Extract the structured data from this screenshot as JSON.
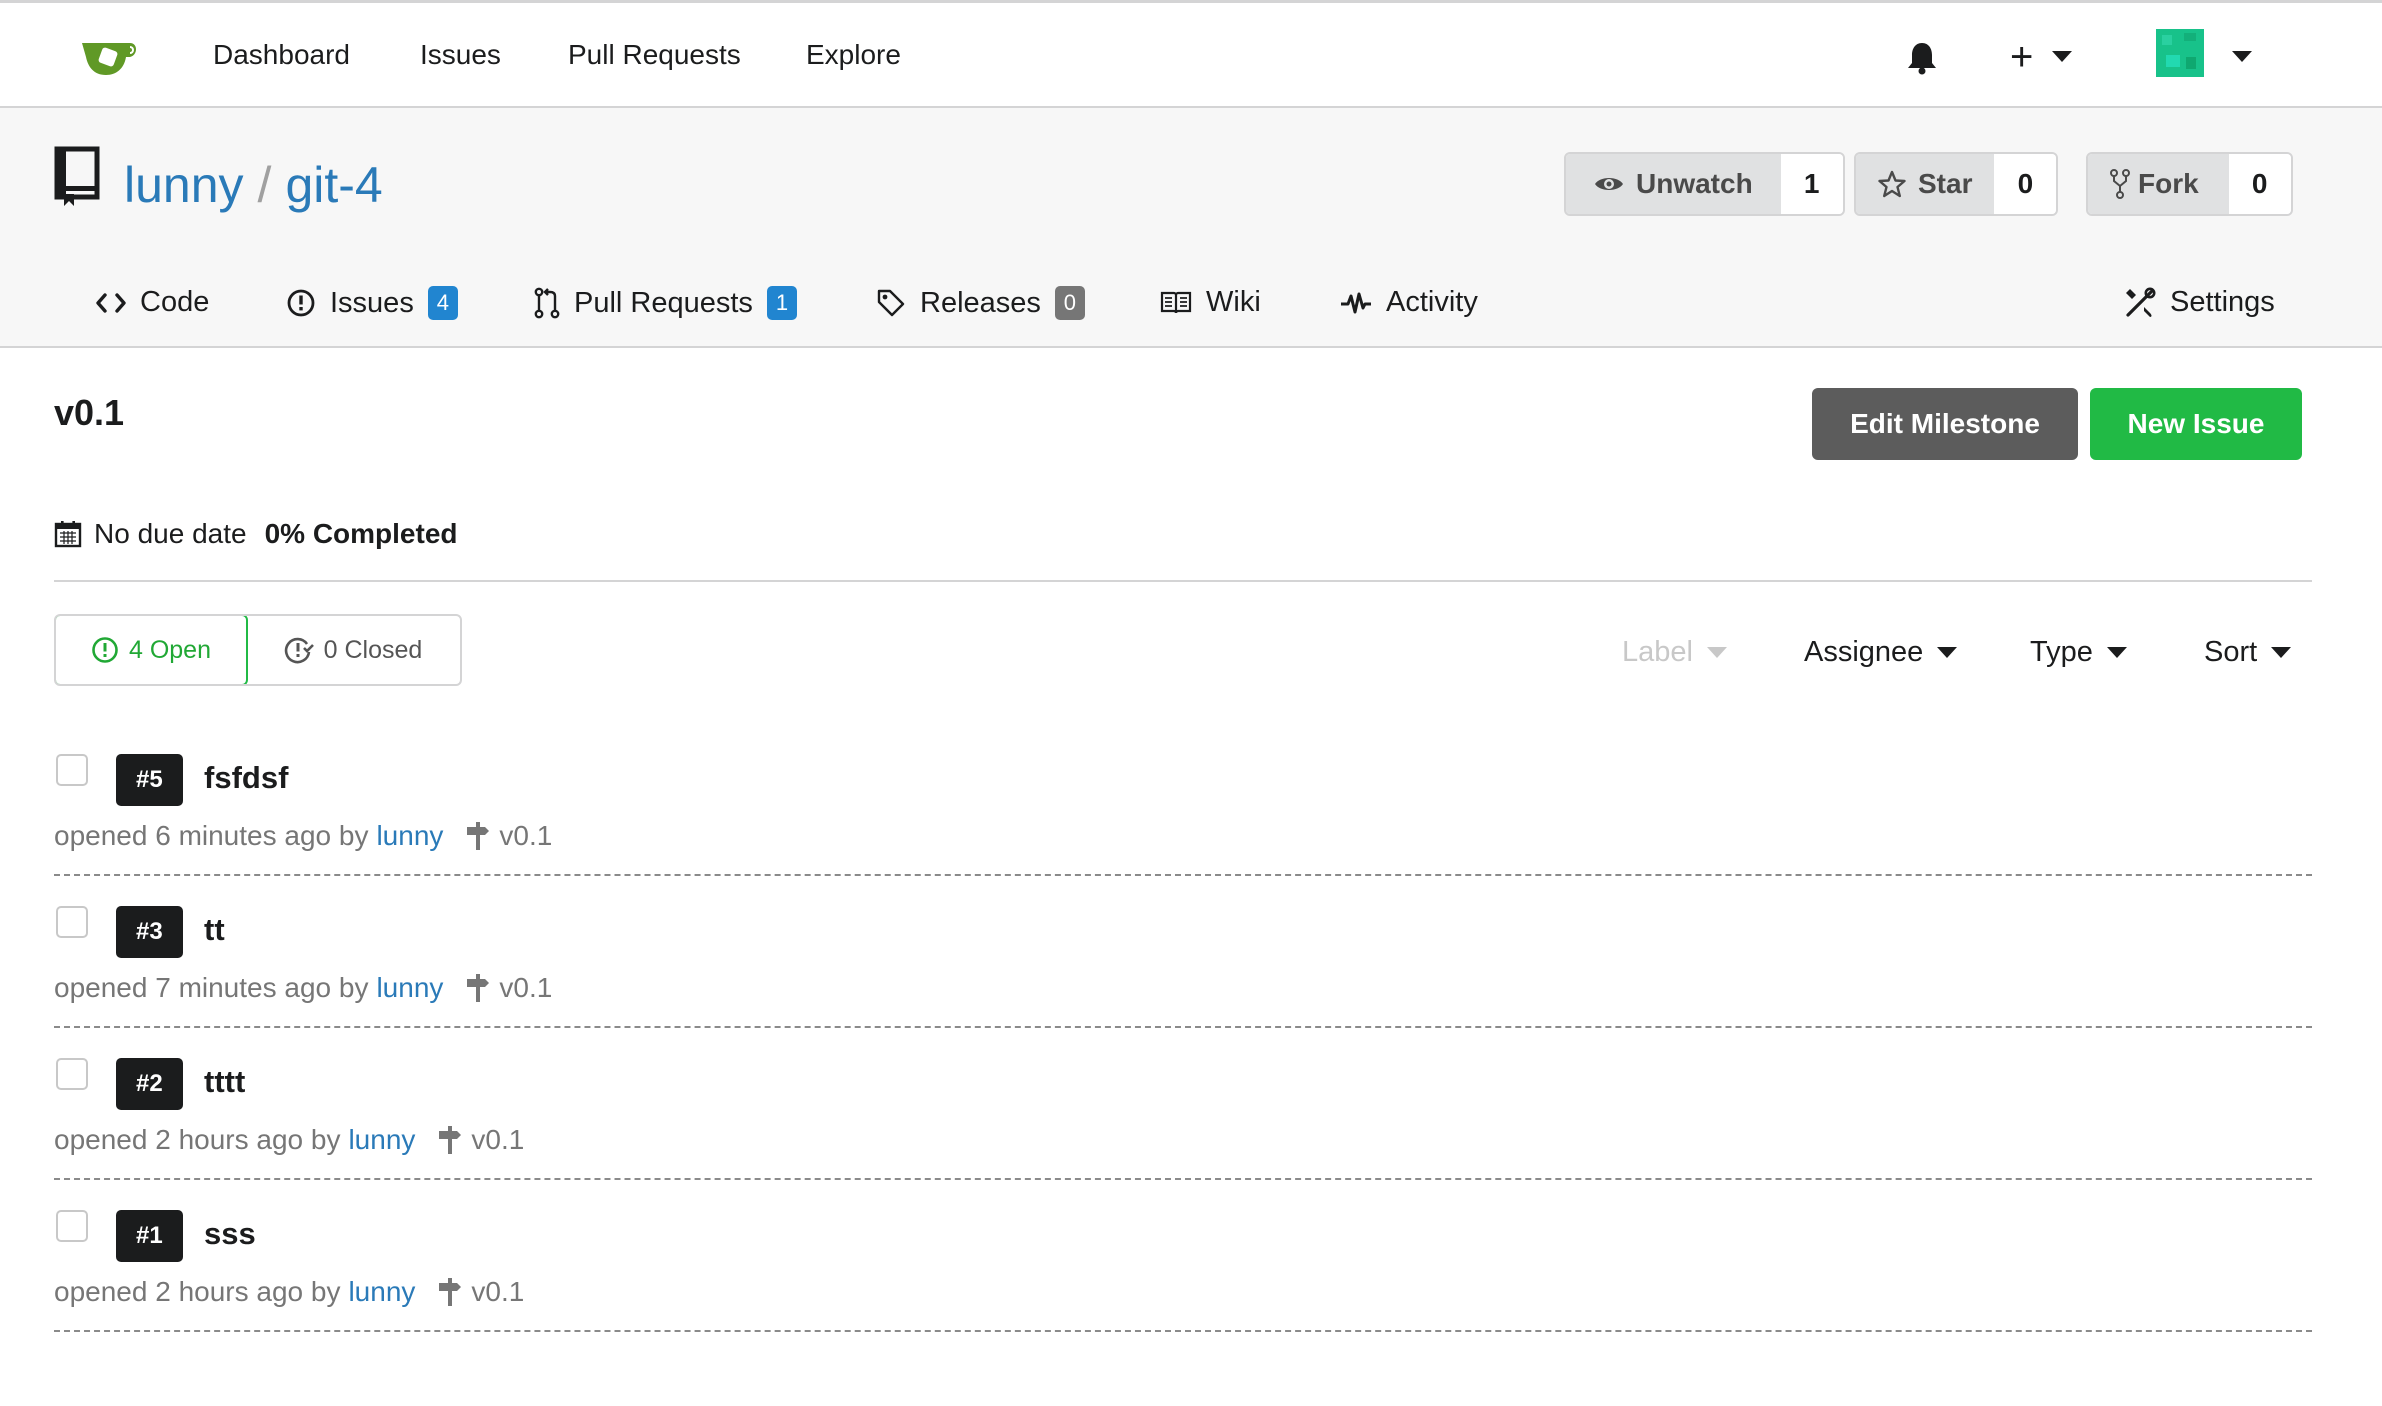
{
  "nav": {
    "links": [
      "Dashboard",
      "Issues",
      "Pull Requests",
      "Explore"
    ],
    "plus_label": "+"
  },
  "repo": {
    "owner": "lunny",
    "separator": "/",
    "name": "git-4",
    "watch": {
      "label": "Unwatch",
      "count": "1"
    },
    "star": {
      "label": "Star",
      "count": "0"
    },
    "fork": {
      "label": "Fork",
      "count": "0"
    }
  },
  "tabs": {
    "code": "Code",
    "issues": {
      "label": "Issues",
      "count": "4"
    },
    "pulls": {
      "label": "Pull Requests",
      "count": "1"
    },
    "releases": {
      "label": "Releases",
      "count": "0"
    },
    "wiki": "Wiki",
    "activity": "Activity",
    "settings": "Settings"
  },
  "milestone": {
    "title": "v0.1",
    "edit_button": "Edit Milestone",
    "new_issue_button": "New Issue",
    "due": "No due date",
    "completed": "0% Completed"
  },
  "states": {
    "open": "4 Open",
    "closed": "0 Closed"
  },
  "filters": {
    "label": "Label",
    "assignee": "Assignee",
    "type": "Type",
    "sort": "Sort"
  },
  "issues": [
    {
      "number": "#5",
      "title": "fsfdsf",
      "opened": "opened 6 minutes ago by",
      "author": "lunny",
      "milestone": "v0.1"
    },
    {
      "number": "#3",
      "title": "tt",
      "opened": "opened 7 minutes ago by",
      "author": "lunny",
      "milestone": "v0.1"
    },
    {
      "number": "#2",
      "title": "tttt",
      "opened": "opened 2 hours ago by",
      "author": "lunny",
      "milestone": "v0.1"
    },
    {
      "number": "#1",
      "title": "sss",
      "opened": "opened 2 hours ago by",
      "author": "lunny",
      "milestone": "v0.1"
    }
  ],
  "colors": {
    "accent_blue": "#2a7ab8",
    "badge_blue": "#2185d0",
    "green": "#21ba45",
    "dark_grey_button": "#5c5c5c",
    "brand_green": "#609926"
  },
  "icons": [
    "gitea-logo-icon",
    "bell-icon",
    "plus-icon",
    "avatar",
    "repo-book-icon",
    "eye-icon",
    "star-icon",
    "fork-icon",
    "code-icon",
    "issue-opened-icon",
    "pull-request-icon",
    "tag-icon",
    "book-icon",
    "pulse-icon",
    "tools-icon",
    "calendar-icon",
    "issue-closed-icon",
    "milestone-icon"
  ]
}
